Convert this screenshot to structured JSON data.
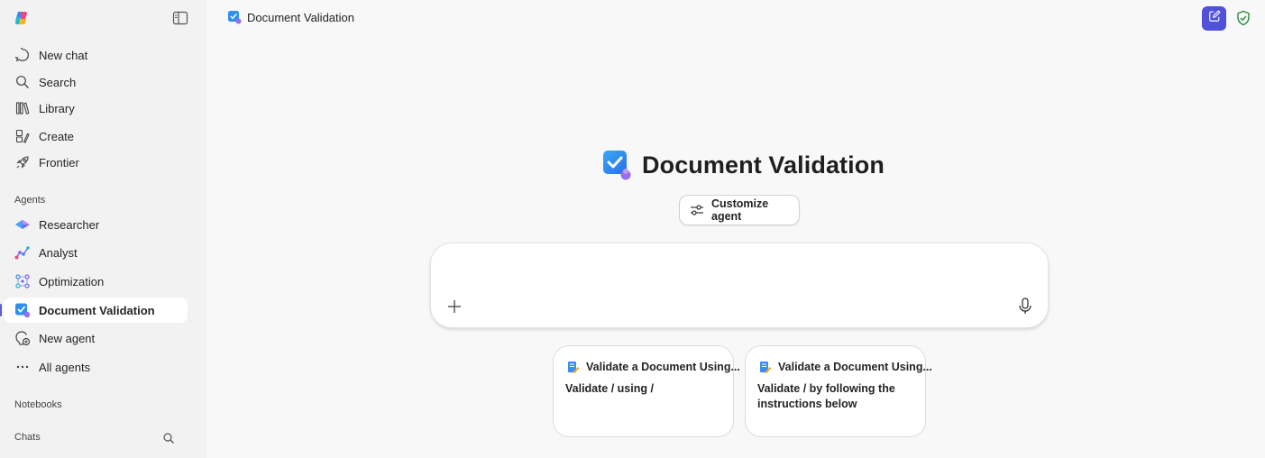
{
  "sidebar": {
    "nav": [
      {
        "label": "New chat",
        "icon": "chat-bubble-icon"
      },
      {
        "label": "Search",
        "icon": "search-icon"
      },
      {
        "label": "Library",
        "icon": "library-icon"
      },
      {
        "label": "Create",
        "icon": "create-icon"
      },
      {
        "label": "Frontier",
        "icon": "rocket-icon"
      }
    ],
    "agents_label": "Agents",
    "agents": [
      {
        "label": "Researcher",
        "icon": "researcher-icon"
      },
      {
        "label": "Analyst",
        "icon": "analyst-icon"
      },
      {
        "label": "Optimization",
        "icon": "optimization-icon"
      },
      {
        "label": "Document Validation",
        "icon": "document-validation-icon",
        "active": true
      },
      {
        "label": "New agent",
        "icon": "new-agent-icon"
      },
      {
        "label": "All agents",
        "icon": "more-icon"
      }
    ],
    "notebooks_label": "Notebooks",
    "chats_label": "Chats"
  },
  "header": {
    "title": "Document Validation"
  },
  "main": {
    "agent_name": "Document Validation",
    "customize_label": "Customize agent",
    "suggestions": [
      {
        "title": "Validate a Document Using...",
        "body": "Validate / using /"
      },
      {
        "title": "Validate a Document Using...",
        "body": "Validate / by following the instructions below"
      }
    ]
  },
  "colors": {
    "accent": "#4f52d8",
    "active_indicator": "#5b5fc7",
    "shield_green": "#2e8b3e"
  }
}
